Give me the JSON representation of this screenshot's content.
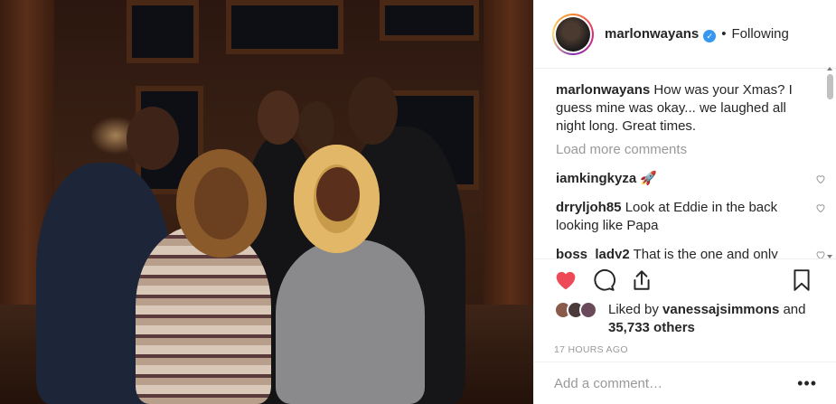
{
  "post": {
    "username": "marlonwayans",
    "follow_status": "Following",
    "separator": "•",
    "verified_mark": "✓"
  },
  "comments": {
    "caption_user": "marlonwayans",
    "caption_text": "How was your Xmas? I guess mine was okay... we laughed all night long. Great times.",
    "load_more": "Load more comments",
    "items": [
      {
        "user": "iamkingkyza",
        "text": "🚀"
      },
      {
        "user": "drryljoh85",
        "text": "Look at Eddie in the back looking like Papa"
      },
      {
        "user": "boss_lady2",
        "text": "That is the one and only Val Young"
      }
    ]
  },
  "actions": {
    "icons": [
      "heart-icon-filled",
      "comment-icon",
      "share-icon",
      "bookmark-icon"
    ],
    "liked_prefix": "Liked by",
    "liked_user": "vanessajsimmons",
    "liked_and": "and",
    "liked_others": "35,733 others",
    "timestamp": "17 HOURS AGO"
  },
  "add_comment": {
    "placeholder": "Add a comment…",
    "more_label": "•••"
  },
  "colors": {
    "like_red": "#ed4956",
    "verified_blue": "#3897f0",
    "muted_gray": "#999999"
  }
}
